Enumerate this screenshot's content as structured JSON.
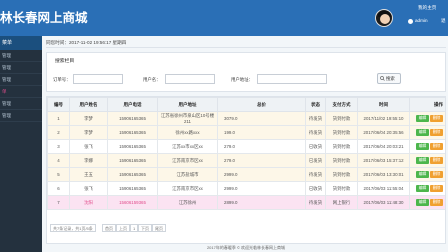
{
  "header": {
    "title": "林长春网上商城",
    "home_link": "我的主页",
    "user_name": "admin",
    "exit_link": "退"
  },
  "sidebar": {
    "title": "菜单",
    "items": [
      "管理",
      "管理",
      "管理",
      "单",
      "管理",
      "管理"
    ]
  },
  "breadcrumb": "同您时间：2017-11-02 19:56:17 星期四",
  "search": {
    "title": "搜索栏目",
    "labels": {
      "order_no": "订单号：",
      "user": "用户名：",
      "address": "用户地址："
    },
    "button": "搜索"
  },
  "table": {
    "columns": [
      "编号",
      "用户姓名",
      "用户电话",
      "用户地址",
      "总价",
      "状态",
      "支付方式",
      "时间",
      "操作"
    ],
    "rows": [
      {
        "id": "1",
        "name": "李梦",
        "phone": "15906165365",
        "address": "江苏省徐州市泉山区10号楼211",
        "price": "3079.0",
        "status": "待发货",
        "pay": "货到付款",
        "time": "2017/11/02 19:55:10",
        "state": "pending"
      },
      {
        "id": "2",
        "name": "李梦",
        "phone": "15906165365",
        "address": "徐州xx路xxx",
        "price": "199.0",
        "status": "待发货",
        "pay": "货到付款",
        "time": "2017/06/04 20:35:56",
        "state": "pending"
      },
      {
        "id": "3",
        "name": "张飞",
        "phone": "15906165365",
        "address": "江苏xx市xx区xx",
        "price": "279.0",
        "status": "已收货",
        "pay": "货到付款",
        "time": "2017/06/04 20:03:21",
        "state": "done"
      },
      {
        "id": "4",
        "name": "李娜",
        "phone": "15906165365",
        "address": "江苏南京市区xx",
        "price": "279.0",
        "status": "已发货",
        "pay": "货到付款",
        "time": "2017/06/03 15:37:12",
        "state": "pending"
      },
      {
        "id": "5",
        "name": "王五",
        "phone": "15906165365",
        "address": "江苏盐城市",
        "price": "2999.0",
        "status": "待发货",
        "pay": "货到付款",
        "time": "2017/06/03 13:30:01",
        "state": "pending"
      },
      {
        "id": "6",
        "name": "张飞",
        "phone": "15906165365",
        "address": "江苏南京市区xx",
        "price": "2999.0",
        "status": "已收货",
        "pay": "货到付款",
        "time": "2017/06/03 11:55:04",
        "state": "done"
      },
      {
        "id": "7",
        "name": "沈阳",
        "phone": "15606159365",
        "address": "江苏徐州",
        "price": "2899.0",
        "status": "待发货",
        "pay": "网上银行",
        "time": "2017/06/03 11:48:30",
        "state": "selected"
      }
    ],
    "actions": {
      "edit": "编辑",
      "delete": "删除"
    }
  },
  "pager": {
    "summary": "共7条记录，共1页/5条",
    "first": "首页",
    "prev": "上页",
    "current": "1",
    "next": "下页",
    "last": "尾页"
  },
  "footer": "2017年的春暖季 © 欢迎光临林长春网上商城",
  "colors": {
    "header": "#2a6fb6",
    "sidebar": "#24313e",
    "edit_button": "#4cb64c",
    "delete_button": "#f0a030",
    "selected_row": "#fbe3f2"
  }
}
